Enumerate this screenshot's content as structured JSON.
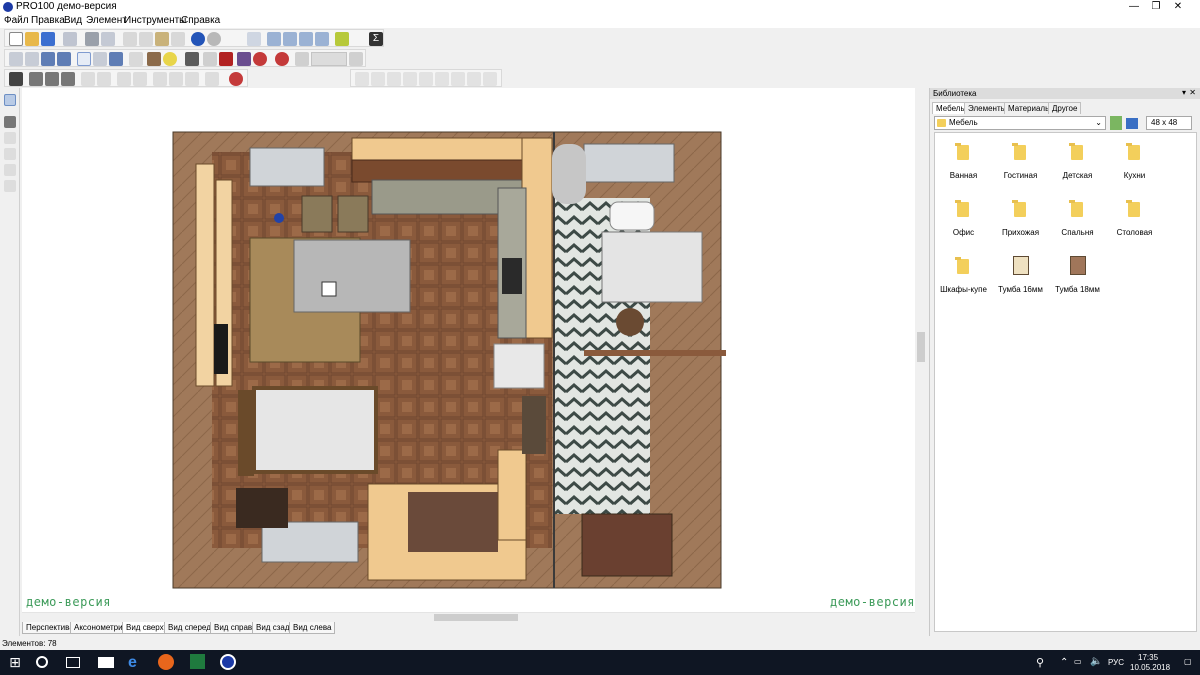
{
  "app": {
    "title": "PRO100 демо-версия"
  },
  "window_controls": {
    "minimize": "—",
    "maximize": "❐",
    "close": "✕"
  },
  "menu": [
    "Файл",
    "Правка",
    "Вид",
    "Элемент",
    "Инструменты",
    "Справка"
  ],
  "view_tabs": [
    "Перспектива",
    "Аксонометрия",
    "Вид сверху",
    "Вид спереди",
    "Вид справа",
    "Вид сзади",
    "Вид слева"
  ],
  "active_view_tab": "Вид сверху",
  "watermark": "демо-версия",
  "status": {
    "text": "Элементов: 78"
  },
  "library": {
    "title": "Библиотека",
    "tabs": [
      "Мебель",
      "Элементы",
      "Материалы",
      "Другое"
    ],
    "active_tab": "Мебель",
    "selected_folder": "Мебель",
    "icon_size": "48 x 48",
    "items": [
      {
        "label": "Ванная",
        "icon": "folder-icon"
      },
      {
        "label": "Гостиная",
        "icon": "folder-icon"
      },
      {
        "label": "Детская",
        "icon": "folder-icon"
      },
      {
        "label": "Кухни",
        "icon": "folder-icon"
      },
      {
        "label": "Офис",
        "icon": "folder-icon"
      },
      {
        "label": "Прихожая",
        "icon": "folder-icon"
      },
      {
        "label": "Спальня",
        "icon": "folder-icon"
      },
      {
        "label": "Столовая",
        "icon": "folder-icon"
      },
      {
        "label": "Шкафы-купе",
        "icon": "folder-icon"
      },
      {
        "label": "Тумба 16мм",
        "icon": "cabinet-icon"
      },
      {
        "label": "Тумба 18мм",
        "icon": "cabinet-icon"
      }
    ]
  },
  "taskbar": {
    "lang": "РУС",
    "time": "17:35",
    "date": "10.05.2018"
  },
  "colors": {
    "accent_blue": "#1c3aa6",
    "folder": "#f3cf5b",
    "watermark": "#3d9b5a",
    "floor_wood": "#a0795a",
    "parquet": "#8a5a3c"
  }
}
